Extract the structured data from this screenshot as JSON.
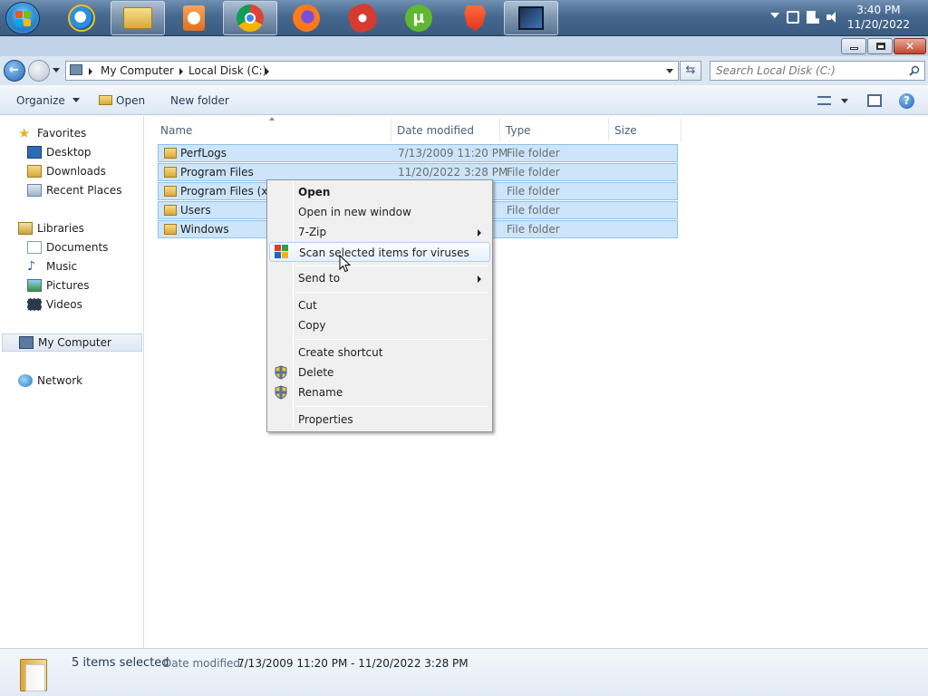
{
  "taskbar": {
    "apps": [
      "explorer",
      "internet-explorer",
      "libraries",
      "media-player",
      "chrome",
      "firefox",
      "ccleaner",
      "utorrent",
      "brave",
      "media-app"
    ],
    "clock_time": "3:40 PM",
    "clock_date": "11/20/2022"
  },
  "address": {
    "crumbs": [
      "My Computer",
      "Local Disk (C:)"
    ],
    "search_placeholder": "Search Local Disk (C:)"
  },
  "toolbar": {
    "organize": "Organize",
    "open": "Open",
    "new_folder": "New folder"
  },
  "nav": {
    "favorites": "Favorites",
    "desktop": "Desktop",
    "downloads": "Downloads",
    "recent": "Recent Places",
    "libraries": "Libraries",
    "documents": "Documents",
    "music": "Music",
    "pictures": "Pictures",
    "videos": "Videos",
    "computer": "My Computer",
    "network": "Network"
  },
  "columns": {
    "name": "Name",
    "date": "Date modified",
    "type": "Type",
    "size": "Size"
  },
  "files": [
    {
      "name": "PerfLogs",
      "date": "7/13/2009 11:20 PM",
      "type": "File folder"
    },
    {
      "name": "Program Files",
      "date": "11/20/2022 3:28 PM",
      "type": "File folder"
    },
    {
      "name": "Program Files (x86",
      "date": "",
      "type": "File folder"
    },
    {
      "name": "Users",
      "date": "",
      "type": "File folder"
    },
    {
      "name": "Windows",
      "date": "",
      "type": "File folder"
    }
  ],
  "context_menu": {
    "open": "Open",
    "open_new": "Open in new window",
    "zip": "7-Zip",
    "scan": "Scan selected items for viruses",
    "send_to": "Send to",
    "cut": "Cut",
    "copy": "Copy",
    "shortcut": "Create shortcut",
    "delete": "Delete",
    "rename": "Rename",
    "properties": "Properties"
  },
  "details": {
    "count": "5 items selected",
    "date_label": "Date modified:",
    "date_value": "7/13/2009 11:20 PM - 11/20/2022 3:28 PM"
  },
  "colors": {
    "selection": "#cce5fb",
    "accent": "#1e395b"
  }
}
